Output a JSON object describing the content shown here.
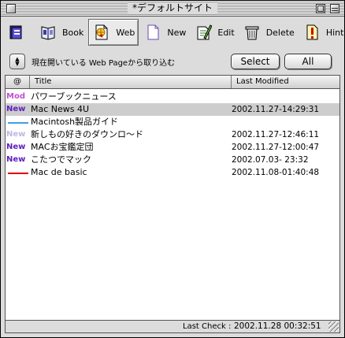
{
  "window": {
    "title": "*デフォルトサイト"
  },
  "toolbar": {
    "items": [
      {
        "label": "",
        "icon": "bookmark-book-icon",
        "color": "#3b2fa8"
      },
      {
        "label": "Book",
        "icon": "book-icon",
        "color": "#3a3ab0"
      },
      {
        "label": "Web",
        "icon": "web-page-icon",
        "color": "#d59a00",
        "active": true
      },
      {
        "label": "New",
        "icon": "new-page-icon",
        "color": "#6a4bb0"
      },
      {
        "label": "Edit",
        "icon": "edit-pencil-icon",
        "color": "#2f7a2f"
      },
      {
        "label": "Delete",
        "icon": "trash-icon",
        "color": "#444444"
      },
      {
        "label": "Hint",
        "icon": "hint-exclamation-icon",
        "color": "#d00000"
      }
    ]
  },
  "command_row": {
    "text": "現在開いている Web Pageから取り込む",
    "select_label": "Select",
    "all_label": "All"
  },
  "table": {
    "columns": {
      "mark": "@",
      "title": "Title",
      "last_modified": "Last Modified"
    },
    "rows": [
      {
        "mark": "Mod",
        "mark_color": "#c050d0",
        "title": "パワーブックニュース",
        "date": ""
      },
      {
        "mark": "New",
        "mark_color": "#6020c0",
        "title": "Mac News 4U",
        "date": "2002.11.27-14:29:31",
        "selected": true
      },
      {
        "mark": "",
        "line_color": "#3aa0e8",
        "title": "Macintosh製品ガイド",
        "date": ""
      },
      {
        "mark": "New",
        "mark_color": "#c0b8e0",
        "title": "新しもの好きのダウンロ～ド",
        "date": "2002.11.27-12:46:11"
      },
      {
        "mark": "New",
        "mark_color": "#6020c0",
        "title": "MACお宝鑑定団",
        "date": "2002.11.27-12:00:47"
      },
      {
        "mark": "New",
        "mark_color": "#6020c0",
        "title": "こたつでマック",
        "date": "2002.07.03- 23:32"
      },
      {
        "mark": "",
        "line_color": "#e00000",
        "title": "Mac de basic",
        "date": "2002.11.08-01:40:48"
      }
    ]
  },
  "status": {
    "label": "Last Check :",
    "value": "2002.11.28 00:32:51"
  }
}
